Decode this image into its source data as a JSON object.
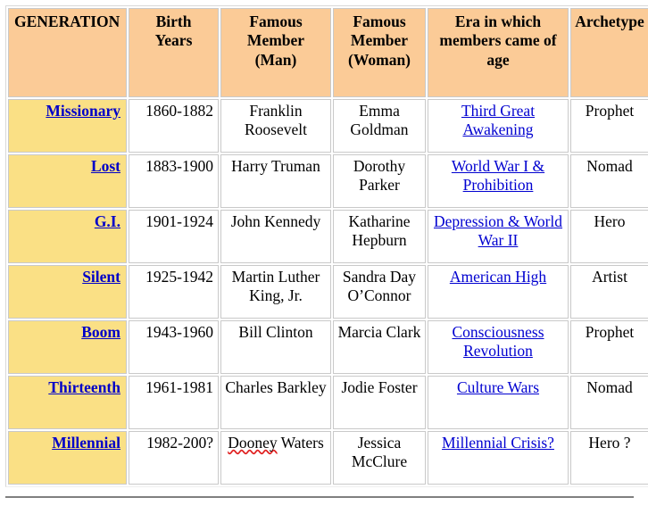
{
  "table": {
    "columns": [
      {
        "key": "generation",
        "label": "GENERATION"
      },
      {
        "key": "years",
        "label": "Birth Years"
      },
      {
        "key": "man",
        "label": "Famous Member (Man)"
      },
      {
        "key": "woman",
        "label": "Famous Member (Woman)"
      },
      {
        "key": "era",
        "label": "Era in which members came of age"
      },
      {
        "key": "archetype",
        "label": "Archetype"
      }
    ],
    "header": {
      "generation": "GENERATION",
      "years_line1": "Birth",
      "years_line2": "Years",
      "man_line1": "Famous",
      "man_line2": "Member",
      "man_line3": "(Man)",
      "woman_line1": "Famous",
      "woman_line2": "Member",
      "woman_line3": "(Woman)",
      "era": "Era in which members came of age",
      "archetype": "Archetype"
    },
    "rows": [
      {
        "generation": "Missionary",
        "years": "1860-1882",
        "man": "Franklin Roosevelt",
        "woman": "Emma Goldman",
        "era": "Third Great Awakening",
        "archetype": "Prophet"
      },
      {
        "generation": "Lost",
        "years": "1883-1900",
        "man": "Harry Truman",
        "woman": "Dorothy Parker",
        "era": "World War I & Prohibition",
        "archetype": "Nomad"
      },
      {
        "generation": "G.I.",
        "years": "1901-1924",
        "man": "John Kennedy",
        "woman": "Katharine Hepburn",
        "era": "Depression & World War II",
        "archetype": "Hero"
      },
      {
        "generation": "Silent",
        "years": "1925-1942",
        "man": "Martin Luther King, Jr.",
        "woman": "Sandra Day O’Connor",
        "era": "American High",
        "archetype": "Artist"
      },
      {
        "generation": "Boom",
        "years": "1943-1960",
        "man": "Bill Clinton",
        "woman": "Marcia Clark",
        "era": "Consciousness Revolution",
        "archetype": "Prophet"
      },
      {
        "generation": "Thirteenth",
        "years": "1961-1981",
        "man": "Charles Barkley",
        "woman": "Jodie Foster",
        "era": "Culture Wars",
        "archetype": "Nomad"
      },
      {
        "generation": "Millennial",
        "years": "1982-200?",
        "man_misspelled": "Dooney",
        "man_rest": " Waters",
        "man": "Dooney Waters",
        "woman": "Jessica McClure",
        "era": "Millennial Crisis?",
        "archetype": "Hero ?"
      }
    ]
  },
  "colors": {
    "header_background": "#FBCB97",
    "generation_cell_background": "#FAE085",
    "link": "#0000C8",
    "era_link": "#0000D0",
    "cell_border": "#C9C9C9",
    "spellcheck_underline": "#E02020",
    "page_background": "#FFFFFF",
    "bottom_rule": "#808080"
  }
}
